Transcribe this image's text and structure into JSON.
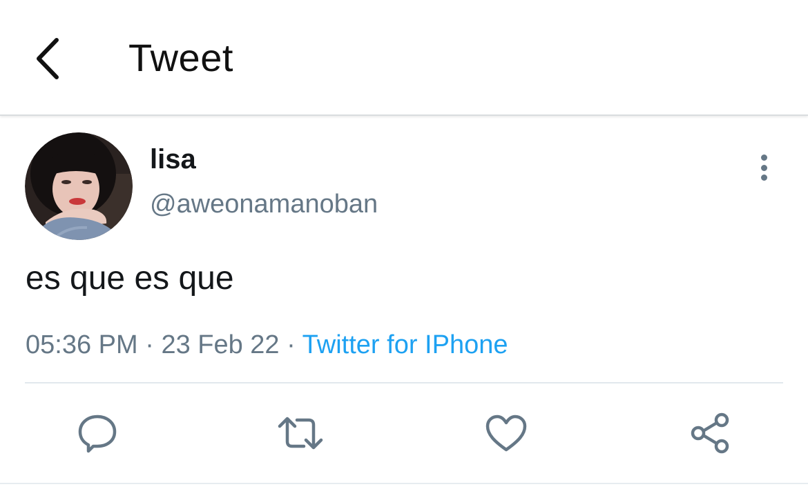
{
  "header": {
    "back_icon": "chevron-left-icon",
    "title": "Tweet"
  },
  "tweet": {
    "author": {
      "display_name": "lisa",
      "handle": "@aweonamanoban",
      "avatar": "profile-photo"
    },
    "text": "es que es que",
    "time": "05:36 PM",
    "separator": "·",
    "date": "23 Feb 22",
    "source": "Twitter for IPhone",
    "more_icon": "more-vertical-icon"
  },
  "actions": [
    {
      "name": "reply",
      "icon": "comment-icon"
    },
    {
      "name": "retweet",
      "icon": "retweet-icon"
    },
    {
      "name": "like",
      "icon": "heart-icon"
    },
    {
      "name": "share",
      "icon": "share-icon"
    }
  ],
  "colors": {
    "accent": "#1da1f2",
    "secondary_text": "#657786",
    "primary_text": "#14171a",
    "divider": "#e1e8ed"
  }
}
